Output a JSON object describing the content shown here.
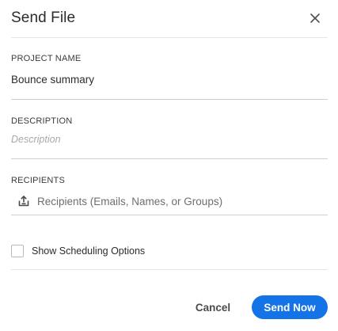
{
  "dialog": {
    "title": "Send File",
    "close_icon": "close-icon"
  },
  "project_name": {
    "label": "PROJECT NAME",
    "value": "Bounce summary"
  },
  "description": {
    "label": "DESCRIPTION",
    "value": "",
    "placeholder": "Description"
  },
  "recipients": {
    "label": "RECIPIENTS",
    "icon": "share-upload-icon",
    "value": "",
    "placeholder": "Recipients (Emails, Names, or Groups)"
  },
  "scheduling": {
    "label": "Show Scheduling Options",
    "checked": false
  },
  "actions": {
    "cancel_label": "Cancel",
    "send_label": "Send Now"
  },
  "colors": {
    "accent": "#1473e6",
    "text": "#2c2c2c",
    "divider": "#cfcfcf"
  }
}
